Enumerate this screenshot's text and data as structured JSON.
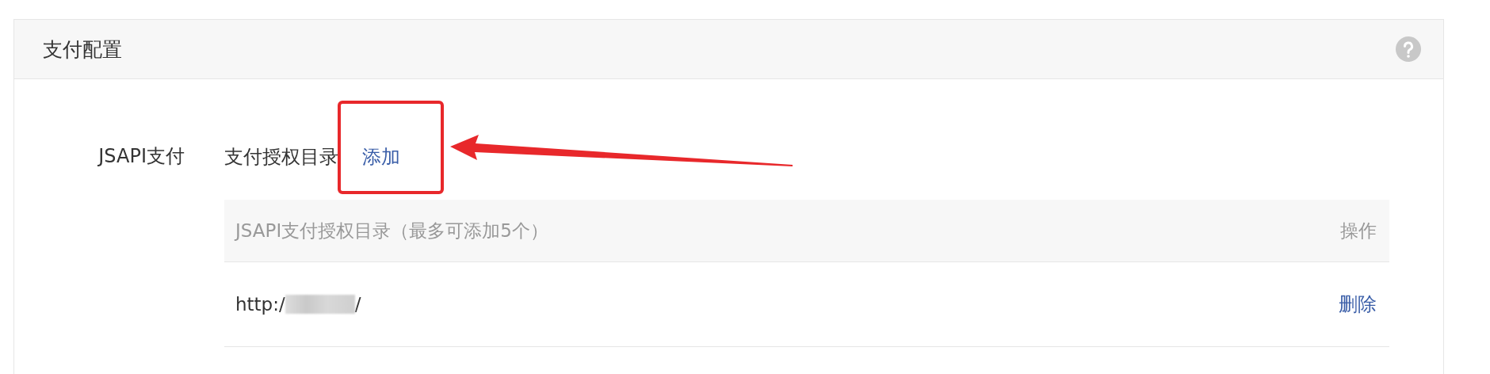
{
  "panel": {
    "title": "支付配置"
  },
  "setting": {
    "label": "JSAPI支付",
    "field_label": "支付授权目录",
    "add_link": "添加"
  },
  "table": {
    "columns": [
      "JSAPI支付授权目录（最多可添加5个）",
      "操作"
    ],
    "rows": [
      {
        "url_prefix": "http:/",
        "url_suffix": "/",
        "action": "删除"
      }
    ]
  }
}
